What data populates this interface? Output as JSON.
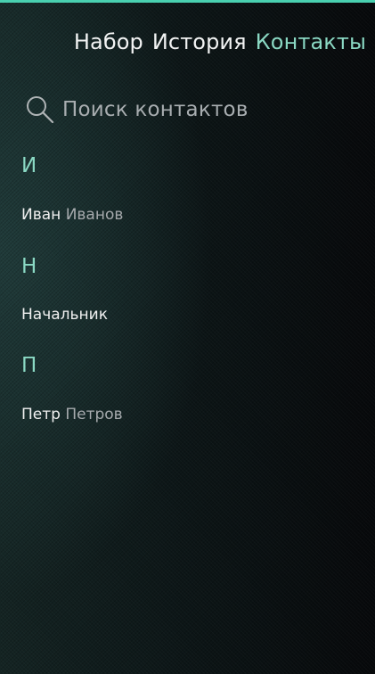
{
  "tabs": [
    {
      "label": "Набор",
      "active": false
    },
    {
      "label": "История",
      "active": false
    },
    {
      "label": "Контакты",
      "active": true
    }
  ],
  "search": {
    "icon": "search-icon",
    "placeholder": "Поиск контактов"
  },
  "sections": [
    {
      "letter": "И",
      "contacts": [
        {
          "first": "Иван",
          "last": "Иванов"
        }
      ]
    },
    {
      "letter": "Н",
      "contacts": [
        {
          "first": "Начальник",
          "last": ""
        }
      ]
    },
    {
      "letter": "П",
      "contacts": [
        {
          "first": "Петр",
          "last": "Петров"
        }
      ]
    }
  ],
  "colors": {
    "accent": "#8ad8c3",
    "top_bar": "#49d0b0",
    "text_primary": "#f0f0f0",
    "text_secondary": "#a6aaad"
  }
}
